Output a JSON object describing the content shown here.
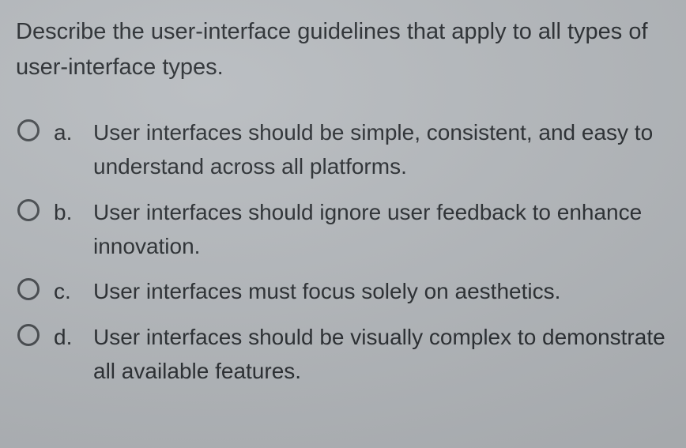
{
  "question": "Describe the user-interface guidelines that apply to all types of user-interface types.",
  "options": [
    {
      "letter": "a.",
      "text": "User interfaces should be simple, consistent, and easy to understand across all platforms."
    },
    {
      "letter": "b.",
      "text": "User interfaces should ignore user feedback to enhance innovation."
    },
    {
      "letter": "c.",
      "text": "User interfaces must focus solely on aesthetics."
    },
    {
      "letter": "d.",
      "text": "User interfaces should be visually complex to demonstrate all available features."
    }
  ]
}
